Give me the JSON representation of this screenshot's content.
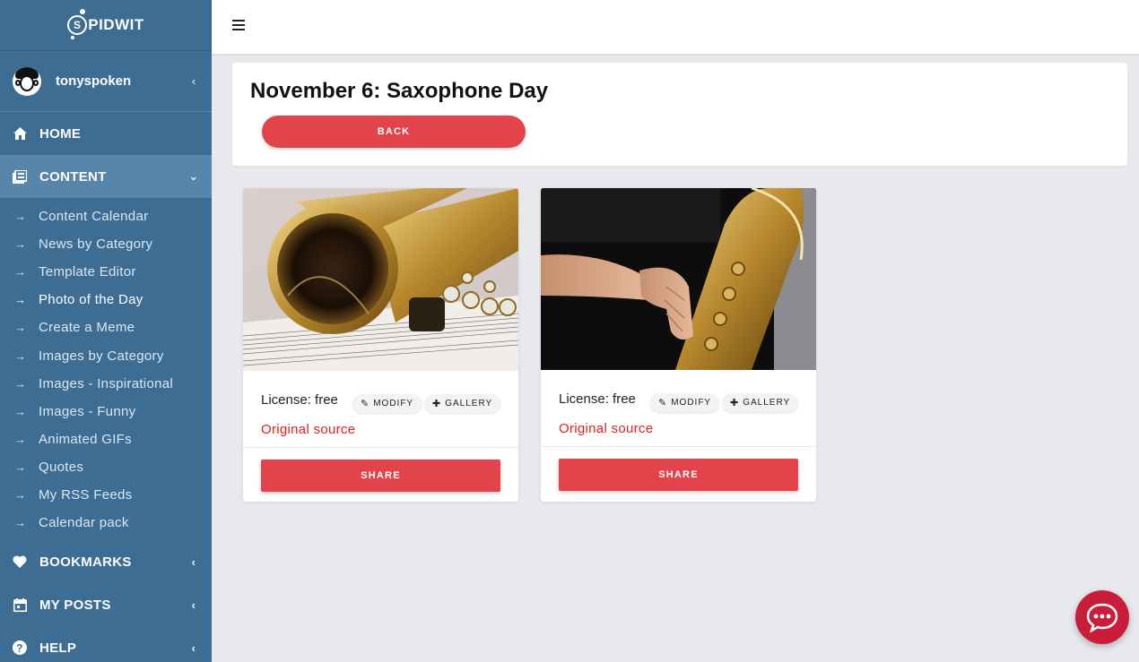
{
  "brand": {
    "name": "PIDWIT",
    "initial": "S"
  },
  "user": {
    "name": "tonyspoken"
  },
  "sidebar": {
    "home": "HOME",
    "content": "CONTENT",
    "content_items": [
      "Content Calendar",
      "News by Category",
      "Template Editor",
      "Photo of the Day",
      "Create a Meme",
      "Images by Category",
      "Images - Inspirational",
      "Images - Funny",
      "Animated GIFs",
      "Quotes",
      "My RSS Feeds",
      "Calendar pack"
    ],
    "current_item": "Photo of the Day",
    "bookmarks": "BOOKMARKS",
    "my_posts": "MY POSTS",
    "help": "HELP"
  },
  "page": {
    "title": "November 6: Saxophone Day",
    "back_label": "BACK"
  },
  "cards": [
    {
      "license": "License: free",
      "modify_label": "MODIFY",
      "gallery_label": "GALLERY",
      "source_label": "Original source",
      "share_label": "SHARE"
    },
    {
      "license": "License: free",
      "modify_label": "MODIFY",
      "gallery_label": "GALLERY",
      "source_label": "Original source",
      "share_label": "SHARE"
    }
  ],
  "colors": {
    "sidebar": "#3e6d94",
    "accent": "#e3434a",
    "link_red": "#e02020",
    "chat": "#c91d3a"
  },
  "icons": [
    "menu-icon",
    "home-icon",
    "content-icon",
    "arrow-right-icon",
    "heart-icon",
    "calendar-icon",
    "help-icon",
    "chevron-left-icon",
    "chevron-down-icon",
    "pencil-icon",
    "plus-icon",
    "chat-icon"
  ]
}
